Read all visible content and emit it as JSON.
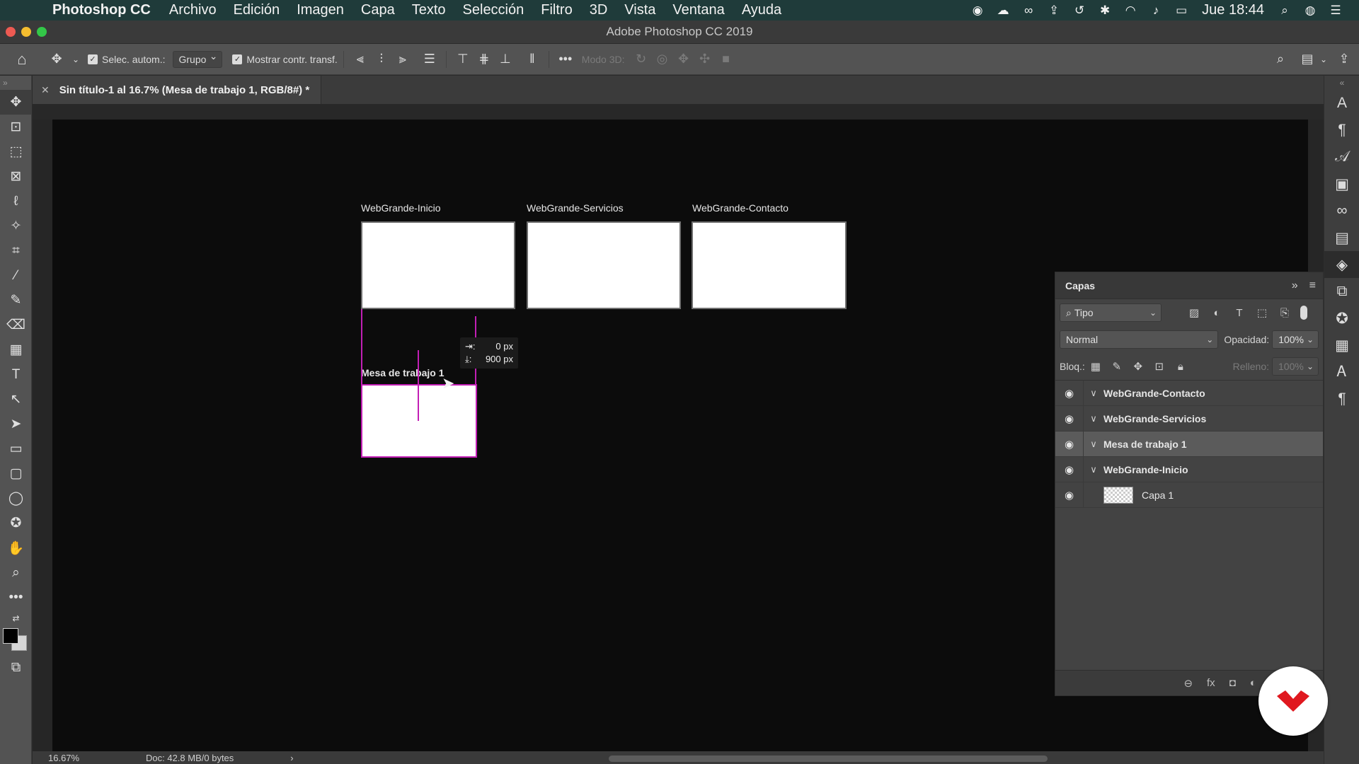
{
  "menubar": {
    "app_name": "Photoshop CC",
    "items": [
      "Archivo",
      "Edición",
      "Imagen",
      "Capa",
      "Texto",
      "Selección",
      "Filtro",
      "3D",
      "Vista",
      "Ventana",
      "Ayuda"
    ],
    "clock": "Jue 18:44"
  },
  "window": {
    "title": "Adobe Photoshop CC 2019"
  },
  "options": {
    "auto_select_label": "Selec. autom.:",
    "auto_select_value": "Grupo",
    "show_transform_label": "Mostrar contr. transf.",
    "mode3d_label": "Modo 3D:"
  },
  "document": {
    "tab_title": "Sin título-1 al 16.7% (Mesa de trabajo 1, RGB/8#) *"
  },
  "artboards": [
    {
      "label": "WebGrande-Inicio"
    },
    {
      "label": "WebGrande-Servicios"
    },
    {
      "label": "WebGrande-Contacto"
    },
    {
      "label": "Mesa de trabajo 1"
    }
  ],
  "measure_tooltip": {
    "dx": "0 px",
    "dy": "900 px"
  },
  "status": {
    "zoom": "16.67%",
    "doc": "Doc: 42.8 MB/0 bytes",
    "arrow": "›"
  },
  "layers_panel": {
    "title": "Capas",
    "filter_value": "Tipo",
    "blend_mode": "Normal",
    "opacity_label": "Opacidad:",
    "opacity_value": "100%",
    "lock_label": "Bloq.:",
    "fill_label": "Relleno:",
    "fill_value": "100%",
    "layers": [
      {
        "name": "WebGrande-Contacto",
        "selected": false
      },
      {
        "name": "WebGrande-Servicios",
        "selected": false
      },
      {
        "name": "Mesa de trabajo 1",
        "selected": true
      },
      {
        "name": "WebGrande-Inicio",
        "selected": false
      },
      {
        "name": "Capa 1",
        "selected": false
      }
    ]
  },
  "colors": {
    "guide": "#c21fb5",
    "menubar": "#1f3b3a",
    "logo_red": "#e0181f"
  }
}
